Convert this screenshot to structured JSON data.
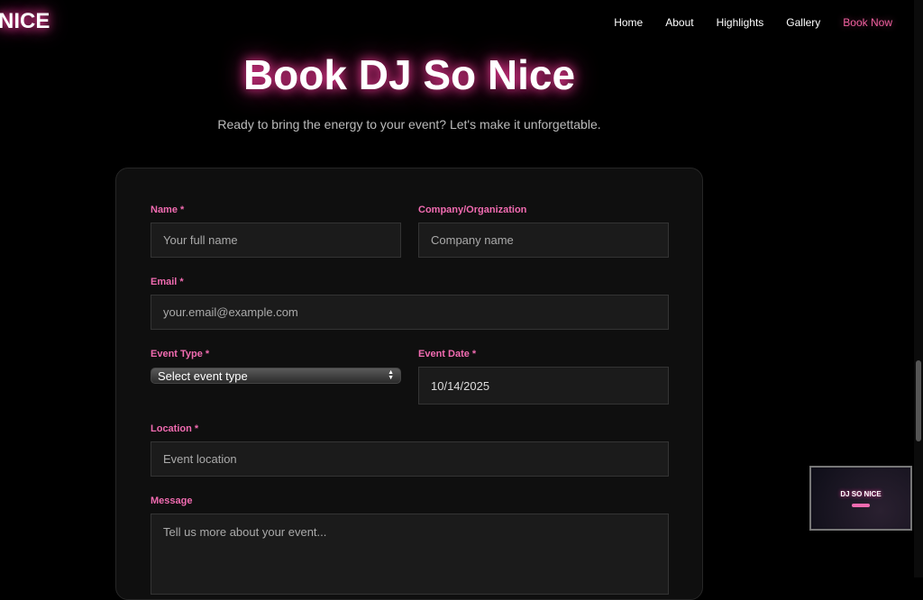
{
  "header": {
    "logo": "NICE",
    "nav": [
      {
        "label": "Home"
      },
      {
        "label": "About"
      },
      {
        "label": "Highlights"
      },
      {
        "label": "Gallery"
      },
      {
        "label": "Book Now",
        "active": true
      }
    ]
  },
  "hero": {
    "title": "Book DJ So Nice",
    "subtitle": "Ready to bring the energy to your event? Let's make it unforgettable."
  },
  "form": {
    "name": {
      "label": "Name *",
      "placeholder": "Your full name"
    },
    "company": {
      "label": "Company/Organization",
      "placeholder": "Company name"
    },
    "email": {
      "label": "Email *",
      "placeholder": "your.email@example.com"
    },
    "event_type": {
      "label": "Event Type *",
      "selected": "Select event type"
    },
    "event_date": {
      "label": "Event Date *",
      "value": "10/14/2025"
    },
    "location": {
      "label": "Location *",
      "placeholder": "Event location"
    },
    "message": {
      "label": "Message",
      "placeholder": "Tell us more about your event..."
    }
  },
  "pip_preview": {
    "title": "DJ SO NICE"
  },
  "colors": {
    "accent": "#f06bb0",
    "background": "#000000",
    "card": "#0f0f0f"
  }
}
